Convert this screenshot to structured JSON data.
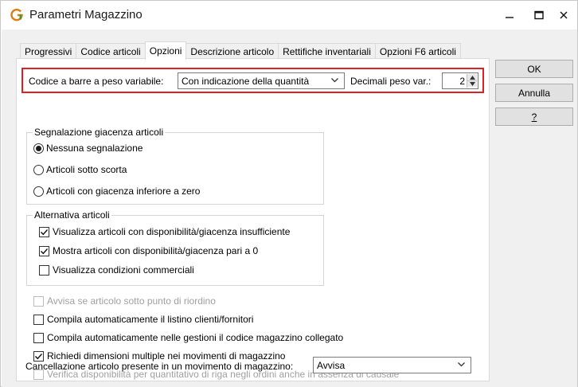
{
  "window": {
    "title": "Parametri Magazzino",
    "app_icon": "g-logo-icon",
    "controls": [
      "minimize-icon",
      "maximize-icon",
      "close-icon"
    ]
  },
  "tabs": [
    {
      "label": "Progressivi",
      "active": false
    },
    {
      "label": "Codice articoli",
      "active": false
    },
    {
      "label": "Opzioni",
      "active": true
    },
    {
      "label": "Descrizione articolo",
      "active": false
    },
    {
      "label": "Rettifiche inventariali",
      "active": false
    },
    {
      "label": "Opzioni F6 articoli",
      "active": false
    }
  ],
  "buttons": {
    "ok": "OK",
    "cancel": "Annulla",
    "help": "?"
  },
  "barcode_row": {
    "label": "Codice a barre a peso variabile:",
    "value": "Con indicazione della quantità",
    "decimals_label": "Decimali peso var.:",
    "decimals_value": "2",
    "highlight_color": "#e02020"
  },
  "stock_signal": {
    "title": "Segnalazione giacenza articoli",
    "options": [
      {
        "label": "Nessuna segnalazione",
        "selected": true
      },
      {
        "label": "Articoli sotto scorta",
        "selected": false
      },
      {
        "label": "Articoli con giacenza inferiore a zero",
        "selected": false
      }
    ]
  },
  "alternatives": {
    "title": "Alternativa articoli",
    "options": [
      {
        "label": "Visualizza articoli con disponibilità/giacenza insufficiente",
        "checked": true
      },
      {
        "label": "Mostra articoli con disponibilità/giacenza pari a 0",
        "checked": true
      },
      {
        "label": "Visualizza condizioni commerciali",
        "checked": false
      }
    ]
  },
  "options": [
    {
      "label": "Avvisa se articolo sotto punto di riordino",
      "checked": false,
      "enabled": false
    },
    {
      "label": "Compila automaticamente il listino clienti/fornitori",
      "checked": false,
      "enabled": true
    },
    {
      "label": "Compila automaticamente nelle gestioni il codice magazzino collegato",
      "checked": false,
      "enabled": true
    },
    {
      "label": "Richiedi dimensioni multiple nei movimenti di magazzino",
      "checked": true,
      "enabled": true
    },
    {
      "label": "Verifica disponibilità per quantitativo di riga negli ordini anche in assenza di causale",
      "checked": false,
      "enabled": false
    }
  ],
  "delete_row": {
    "label": "Cancellazione articolo presente in un movimento di magazzino:",
    "value": "Avvisa"
  }
}
